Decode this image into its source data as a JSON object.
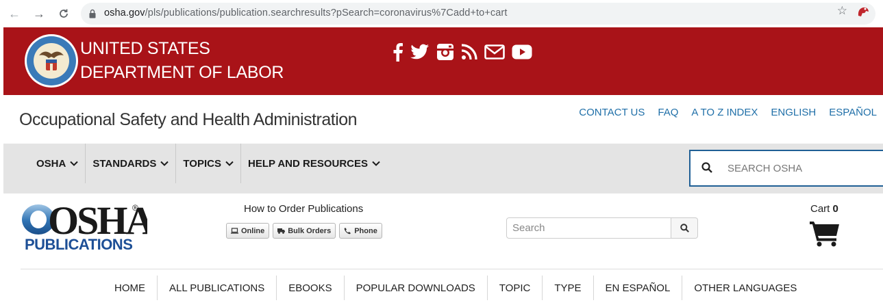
{
  "browser": {
    "url_host": "osha.gov",
    "url_path": "/pls/publications/publication.searchresults?pSearch=coronavirus%7Cadd+to+cart"
  },
  "dol": {
    "line1": "UNITED STATES",
    "line2": "DEPARTMENT OF LABOR",
    "social_icons": [
      "facebook-icon",
      "twitter-icon",
      "instagram-icon",
      "rss-icon",
      "email-icon",
      "youtube-icon"
    ],
    "banner_color": "#a91318"
  },
  "header": {
    "agency_name": "Occupational Safety and Health Administration",
    "links": [
      "CONTACT US",
      "FAQ",
      "A TO Z INDEX",
      "ENGLISH",
      "ESPAÑOL"
    ],
    "link_color": "#1f6fa8"
  },
  "main_nav": {
    "items": [
      "OSHA",
      "STANDARDS",
      "TOPICS",
      "HELP AND RESOURCES"
    ],
    "search_placeholder": "SEARCH OSHA"
  },
  "publications": {
    "logo_word": "OSHA",
    "logo_sub": "PUBLICATIONS",
    "logo_mark": "®",
    "order_title": "How to Order Publications",
    "order_buttons": [
      "Online",
      "Bulk Orders",
      "Phone"
    ],
    "search_placeholder": "Search",
    "cart_label": "Cart",
    "cart_count": "0"
  },
  "pub_nav": {
    "items": [
      "HOME",
      "ALL PUBLICATIONS",
      "EBOOKS",
      "POPULAR DOWNLOADS",
      "TOPIC",
      "TYPE",
      "EN ESPAÑOL",
      "OTHER LANGUAGES"
    ]
  }
}
